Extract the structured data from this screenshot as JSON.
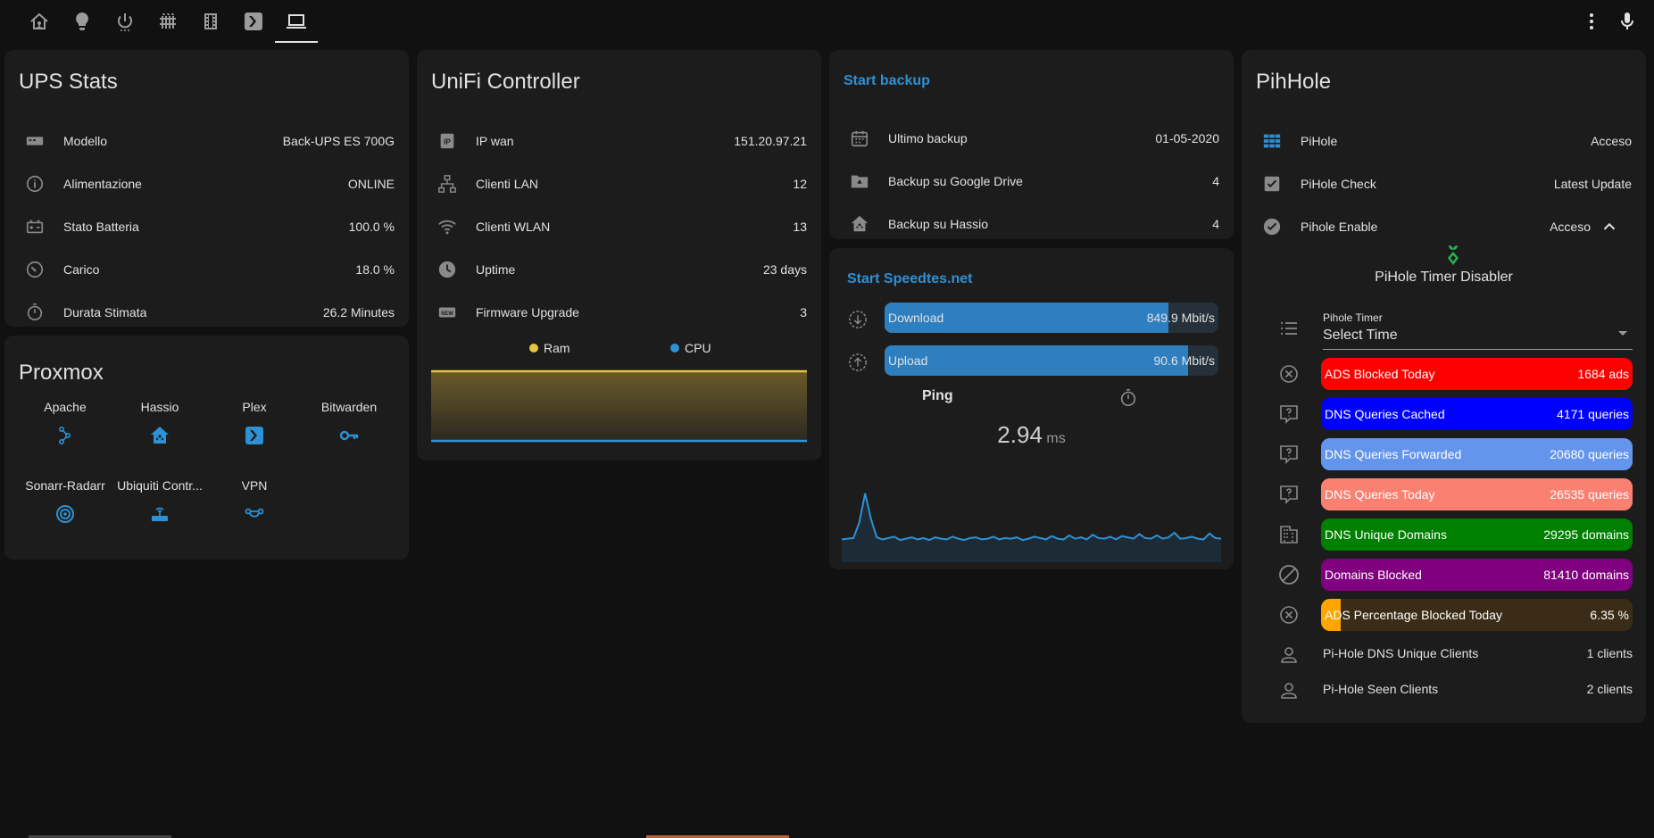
{
  "topbar": {
    "icons": [
      "home-network-icon",
      "lightbulb-icon",
      "power-icon",
      "heater-icon",
      "film-icon",
      "plex-icon",
      "laptop-icon"
    ],
    "menu_icon": "dots-vertical-icon",
    "mic_icon": "microphone-icon"
  },
  "ups": {
    "title": "UPS Stats",
    "rows": [
      {
        "label": "Modello",
        "value": "Back-UPS ES 700G",
        "icon": "ups-icon"
      },
      {
        "label": "Alimentazione",
        "value": "ONLINE",
        "icon": "info-icon"
      },
      {
        "label": "Stato Batteria",
        "value": "100.0 %",
        "icon": "battery-icon"
      },
      {
        "label": "Carico",
        "value": "18.0 %",
        "icon": "gauge-icon"
      },
      {
        "label": "Durata Stimata",
        "value": "26.2 Minutes",
        "icon": "timer-icon"
      }
    ]
  },
  "proxmox": {
    "title": "Proxmox",
    "tiles": [
      {
        "label": "Apache",
        "icon": "apache-icon"
      },
      {
        "label": "Hassio",
        "icon": "home-assistant-icon"
      },
      {
        "label": "Plex",
        "icon": "plex-icon"
      },
      {
        "label": "Bitwarden",
        "icon": "key-icon"
      },
      {
        "label": "Sonarr-Radarr",
        "icon": "radar-icon"
      },
      {
        "label": "Ubiquiti Contr...",
        "icon": "router-icon"
      },
      {
        "label": "VPN",
        "icon": "vpn-icon"
      }
    ]
  },
  "unifi": {
    "title": "UniFi Controller",
    "rows": [
      {
        "label": "IP wan",
        "value": "151.20.97.21",
        "icon": "ip-icon"
      },
      {
        "label": "Clienti LAN",
        "value": "12",
        "icon": "lan-icon"
      },
      {
        "label": "Clienti WLAN",
        "value": "13",
        "icon": "wifi-icon"
      },
      {
        "label": "Uptime",
        "value": "23 days",
        "icon": "clock-icon"
      },
      {
        "label": "Firmware Upgrade",
        "value": "3",
        "icon": "new-box-icon"
      }
    ],
    "legend": [
      {
        "name": "Ram",
        "color": "#e5c540"
      },
      {
        "name": "CPU",
        "color": "#2e91d4"
      }
    ]
  },
  "backup": {
    "title": "Start backup",
    "rows": [
      {
        "label": "Ultimo backup",
        "value": "01-05-2020",
        "icon": "calendar-icon"
      },
      {
        "label": "Backup su Google Drive",
        "value": "4",
        "icon": "folder-drive-icon"
      },
      {
        "label": "Backup su Hassio",
        "value": "4",
        "icon": "home-assistant-icon"
      }
    ]
  },
  "speedtest": {
    "title": "Start Speedtes.net",
    "download": {
      "label": "Download",
      "value": "849.9 Mbit/s",
      "fraction": 0.85
    },
    "upload": {
      "label": "Upload",
      "value": "90.6 Mbit/s",
      "fraction": 0.91
    },
    "ping_label": "Ping",
    "ping_value": "2.94",
    "ping_unit": "ms",
    "bar_color": "#2e7fc0",
    "chart_data": {
      "type": "line",
      "title": "",
      "xlabel": "",
      "ylabel": "",
      "values": [
        2.9,
        3.0,
        3.1,
        5.4,
        9.8,
        6.0,
        3.2,
        2.9,
        3.1,
        3.3,
        2.8,
        3.0,
        3.2,
        2.9,
        3.1,
        2.8,
        3.2,
        3.0,
        2.9,
        3.3,
        3.0,
        2.8,
        3.1,
        3.2,
        2.9,
        3.0,
        3.3,
        2.9,
        3.1,
        3.0,
        3.2,
        2.8,
        3.0,
        3.3,
        3.1,
        2.9,
        3.4,
        3.0,
        2.9,
        3.5,
        3.0,
        3.2,
        2.9,
        3.6,
        3.1,
        3.0,
        3.3,
        2.9,
        3.4,
        3.2,
        3.0,
        3.7,
        3.1,
        3.0,
        3.5,
        3.0,
        3.2,
        3.9,
        3.0,
        3.1,
        3.3,
        3.0,
        2.9,
        3.8,
        3.1,
        3.0
      ]
    }
  },
  "pihole": {
    "title": "PihHole",
    "rows": [
      {
        "label": "PiHole",
        "value": "Acceso",
        "icon": "pihole-grid-icon",
        "icon_color": "#2e91d4"
      },
      {
        "label": "PiHole Check",
        "value": "Latest Update",
        "icon": "checkbox-icon",
        "icon_color": "#8a8a8a"
      },
      {
        "label": "Pihole Enable",
        "value": "Acceso",
        "icon": "check-circle-icon",
        "icon_color": "#8a8a8a"
      }
    ],
    "chevron_icon": "chevron-up-icon",
    "timer_title": "PiHole Timer Disabler",
    "timer_icon": "pihole-logo-icon",
    "select_label": "Pihole Timer",
    "select_value": "Select Time",
    "bars": [
      {
        "label": "ADS Blocked Today",
        "value": "1684 ads",
        "color": "#ff0000",
        "bg": "#ff0000",
        "fraction": 1,
        "icon": "close-circle-icon"
      },
      {
        "label": "DNS Queries Cached",
        "value": "4171 queries",
        "color": "#0000ff",
        "bg": "#0000ff",
        "fraction": 1,
        "icon": "comment-question-icon"
      },
      {
        "label": "DNS Queries Forwarded",
        "value": "20680 queries",
        "color": "#6495ed",
        "bg": "#6495ed",
        "fraction": 1,
        "icon": "comment-question-icon"
      },
      {
        "label": "DNS Queries Today",
        "value": "26535 queries",
        "color": "#fa8072",
        "bg": "#fa8072",
        "fraction": 1,
        "icon": "comment-question-icon"
      },
      {
        "label": "DNS Unique Domains",
        "value": "29295 domains",
        "color": "#008000",
        "bg": "#008000",
        "fraction": 1,
        "icon": "domain-icon"
      },
      {
        "label": "Domains Blocked",
        "value": "81410 domains",
        "color": "#800080",
        "bg": "#800080",
        "fraction": 1,
        "icon": "cancel-icon"
      },
      {
        "label": "ADS Percentage Blocked Today",
        "value": "6.35 %",
        "color": "#ffa500",
        "bg": "#3a2c16",
        "fraction": 0.0635,
        "icon": "close-circle-icon"
      }
    ],
    "clients": [
      {
        "label": "Pi-Hole DNS Unique Clients",
        "value": "1 clients",
        "icon": "account-icon"
      },
      {
        "label": "Pi-Hole Seen Clients",
        "value": "2 clients",
        "icon": "account-icon"
      }
    ]
  }
}
